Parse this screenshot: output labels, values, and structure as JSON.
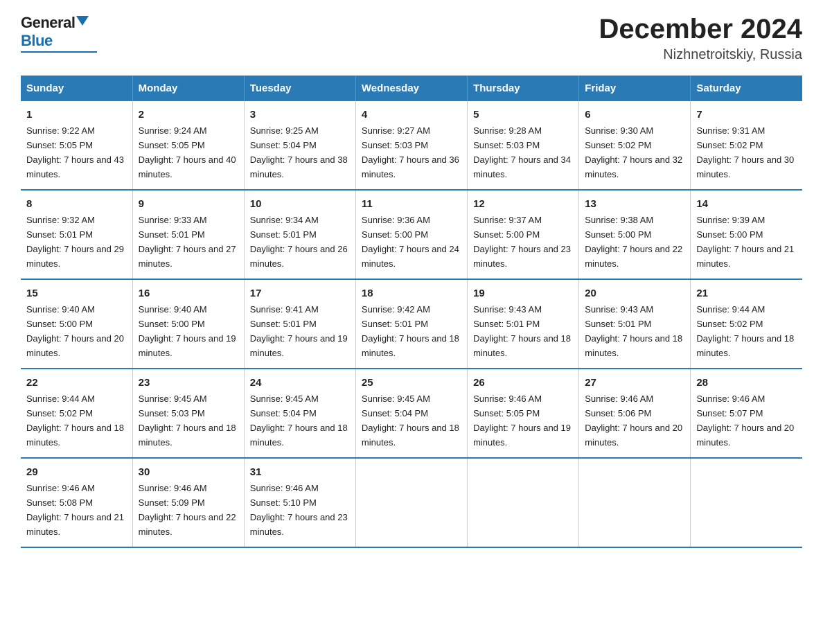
{
  "logo": {
    "general": "General",
    "blue": "Blue"
  },
  "title": "December 2024",
  "subtitle": "Nizhnetroitskiy, Russia",
  "days": [
    "Sunday",
    "Monday",
    "Tuesday",
    "Wednesday",
    "Thursday",
    "Friday",
    "Saturday"
  ],
  "weeks": [
    [
      {
        "num": "1",
        "sunrise": "9:22 AM",
        "sunset": "5:05 PM",
        "daylight": "7 hours and 43 minutes."
      },
      {
        "num": "2",
        "sunrise": "9:24 AM",
        "sunset": "5:05 PM",
        "daylight": "7 hours and 40 minutes."
      },
      {
        "num": "3",
        "sunrise": "9:25 AM",
        "sunset": "5:04 PM",
        "daylight": "7 hours and 38 minutes."
      },
      {
        "num": "4",
        "sunrise": "9:27 AM",
        "sunset": "5:03 PM",
        "daylight": "7 hours and 36 minutes."
      },
      {
        "num": "5",
        "sunrise": "9:28 AM",
        "sunset": "5:03 PM",
        "daylight": "7 hours and 34 minutes."
      },
      {
        "num": "6",
        "sunrise": "9:30 AM",
        "sunset": "5:02 PM",
        "daylight": "7 hours and 32 minutes."
      },
      {
        "num": "7",
        "sunrise": "9:31 AM",
        "sunset": "5:02 PM",
        "daylight": "7 hours and 30 minutes."
      }
    ],
    [
      {
        "num": "8",
        "sunrise": "9:32 AM",
        "sunset": "5:01 PM",
        "daylight": "7 hours and 29 minutes."
      },
      {
        "num": "9",
        "sunrise": "9:33 AM",
        "sunset": "5:01 PM",
        "daylight": "7 hours and 27 minutes."
      },
      {
        "num": "10",
        "sunrise": "9:34 AM",
        "sunset": "5:01 PM",
        "daylight": "7 hours and 26 minutes."
      },
      {
        "num": "11",
        "sunrise": "9:36 AM",
        "sunset": "5:00 PM",
        "daylight": "7 hours and 24 minutes."
      },
      {
        "num": "12",
        "sunrise": "9:37 AM",
        "sunset": "5:00 PM",
        "daylight": "7 hours and 23 minutes."
      },
      {
        "num": "13",
        "sunrise": "9:38 AM",
        "sunset": "5:00 PM",
        "daylight": "7 hours and 22 minutes."
      },
      {
        "num": "14",
        "sunrise": "9:39 AM",
        "sunset": "5:00 PM",
        "daylight": "7 hours and 21 minutes."
      }
    ],
    [
      {
        "num": "15",
        "sunrise": "9:40 AM",
        "sunset": "5:00 PM",
        "daylight": "7 hours and 20 minutes."
      },
      {
        "num": "16",
        "sunrise": "9:40 AM",
        "sunset": "5:00 PM",
        "daylight": "7 hours and 19 minutes."
      },
      {
        "num": "17",
        "sunrise": "9:41 AM",
        "sunset": "5:01 PM",
        "daylight": "7 hours and 19 minutes."
      },
      {
        "num": "18",
        "sunrise": "9:42 AM",
        "sunset": "5:01 PM",
        "daylight": "7 hours and 18 minutes."
      },
      {
        "num": "19",
        "sunrise": "9:43 AM",
        "sunset": "5:01 PM",
        "daylight": "7 hours and 18 minutes."
      },
      {
        "num": "20",
        "sunrise": "9:43 AM",
        "sunset": "5:01 PM",
        "daylight": "7 hours and 18 minutes."
      },
      {
        "num": "21",
        "sunrise": "9:44 AM",
        "sunset": "5:02 PM",
        "daylight": "7 hours and 18 minutes."
      }
    ],
    [
      {
        "num": "22",
        "sunrise": "9:44 AM",
        "sunset": "5:02 PM",
        "daylight": "7 hours and 18 minutes."
      },
      {
        "num": "23",
        "sunrise": "9:45 AM",
        "sunset": "5:03 PM",
        "daylight": "7 hours and 18 minutes."
      },
      {
        "num": "24",
        "sunrise": "9:45 AM",
        "sunset": "5:04 PM",
        "daylight": "7 hours and 18 minutes."
      },
      {
        "num": "25",
        "sunrise": "9:45 AM",
        "sunset": "5:04 PM",
        "daylight": "7 hours and 18 minutes."
      },
      {
        "num": "26",
        "sunrise": "9:46 AM",
        "sunset": "5:05 PM",
        "daylight": "7 hours and 19 minutes."
      },
      {
        "num": "27",
        "sunrise": "9:46 AM",
        "sunset": "5:06 PM",
        "daylight": "7 hours and 20 minutes."
      },
      {
        "num": "28",
        "sunrise": "9:46 AM",
        "sunset": "5:07 PM",
        "daylight": "7 hours and 20 minutes."
      }
    ],
    [
      {
        "num": "29",
        "sunrise": "9:46 AM",
        "sunset": "5:08 PM",
        "daylight": "7 hours and 21 minutes."
      },
      {
        "num": "30",
        "sunrise": "9:46 AM",
        "sunset": "5:09 PM",
        "daylight": "7 hours and 22 minutes."
      },
      {
        "num": "31",
        "sunrise": "9:46 AM",
        "sunset": "5:10 PM",
        "daylight": "7 hours and 23 minutes."
      },
      null,
      null,
      null,
      null
    ]
  ]
}
